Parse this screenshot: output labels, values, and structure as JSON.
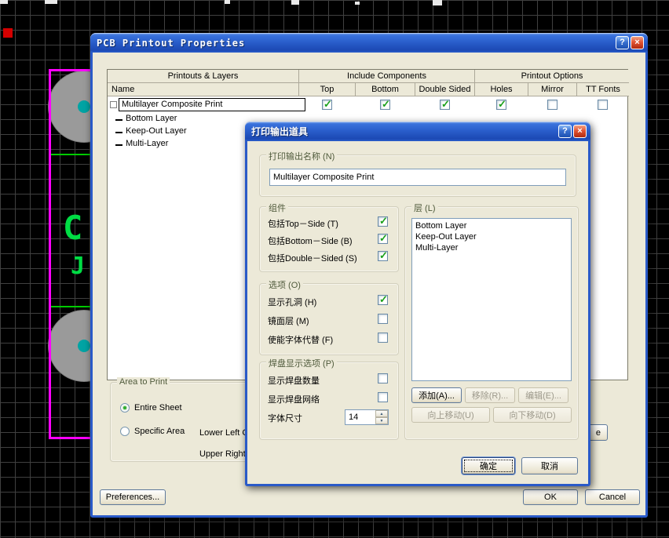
{
  "icons": {
    "help": "?",
    "close": "×",
    "spin_up": "▲",
    "spin_down": "▼"
  },
  "pcb": {
    "glyph_c": "C",
    "glyph_j": "J"
  },
  "main_dialog": {
    "title": "PCB Printout Properties",
    "table": {
      "group_headers": [
        "Printouts & Layers",
        "Include Components",
        "Printout Options"
      ],
      "columns": [
        "Name",
        "Top",
        "Bottom",
        "Double Sided",
        "Holes",
        "Mirror",
        "TT Fonts"
      ],
      "row": {
        "name": "Multilayer Composite Print",
        "top": true,
        "bottom": true,
        "double_sided": true,
        "holes": true,
        "mirror": false,
        "tt_fonts": false
      },
      "tree_items": [
        "Bottom Layer",
        "Keep-Out Layer",
        "Multi-Layer"
      ]
    },
    "area_group": {
      "label": "Area to Print",
      "entire_sheet_label": "Entire Sheet",
      "entire_sheet_selected": true,
      "specific_area_label": "Specific Area",
      "specific_area_selected": false,
      "lower_left_label": "Lower Left C",
      "upper_right_label": "Upper Right"
    },
    "preferences_label": "Preferences...",
    "ok_label": "OK",
    "cancel_label": "Cancel",
    "partial_button_label": "e"
  },
  "child_dialog": {
    "title": "打印输出道具",
    "name_group": {
      "label": "打印输出名称 (N)",
      "value": "Multilayer Composite Print"
    },
    "components_group": {
      "label": "组件",
      "items": [
        {
          "label": "包括Top－Side (T)",
          "checked": true
        },
        {
          "label": "包括Bottom－Side (B)",
          "checked": true
        },
        {
          "label": "包括Double－Sided (S)",
          "checked": true
        }
      ]
    },
    "options_group": {
      "label": "选项 (O)",
      "items": [
        {
          "label": "显示孔洞 (H)",
          "checked": true
        },
        {
          "label": "镜面层 (M)",
          "checked": false
        },
        {
          "label": "使能字体代替 (F)",
          "checked": false
        }
      ]
    },
    "pad_group": {
      "label": "焊盘显示选项 (P)",
      "items": [
        {
          "label": "显示焊盘数量",
          "checked": false
        },
        {
          "label": "显示焊盘网络",
          "checked": false
        }
      ],
      "font_size_label": "字体尺寸",
      "font_size_value": "14"
    },
    "layers_group": {
      "label": "层 (L)",
      "items": [
        "Bottom Layer",
        "Keep-Out Layer",
        "Multi-Layer"
      ],
      "add_label": "添加(A)...",
      "remove_label": "移除(R)...",
      "edit_label": "编辑(E)...",
      "move_up_label": "向上移动(U)",
      "move_down_label": "向下移动(D)"
    },
    "ok_label": "确定",
    "cancel_label": "取消"
  }
}
